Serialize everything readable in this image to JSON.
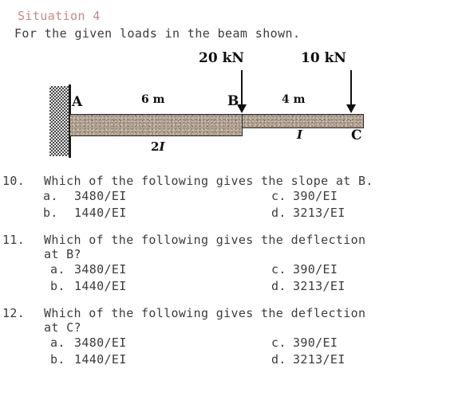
{
  "header": {
    "situation_title": "Situation 4",
    "intro": "For the given loads in the beam shown."
  },
  "figure": {
    "load_left_label": "20 kN",
    "load_right_label": "10 kN",
    "dim_left_label": "6 m",
    "dim_right_label": "4 m",
    "node_a": "A",
    "node_b": "B",
    "node_c": "C",
    "inertia_left_prefix": "2",
    "inertia_left_symbol": "I",
    "inertia_right_symbol": "I",
    "beam_type": "cantilever",
    "support": "fixed-wall-at-A",
    "colors": {
      "beam_fill": "#b0a08f",
      "beam_outline": "#2a2a2a",
      "wall_hatch": "#4a4a4a",
      "arrow": "#111111",
      "title": "#d4837f",
      "body_text": "#3c3c3c"
    }
  },
  "questions": [
    {
      "number": "10.",
      "text_line1": "Which of the following gives the slope at B.",
      "text_line2": "",
      "options": [
        {
          "key": "a.",
          "value": "3480/EI"
        },
        {
          "key": "c.",
          "value": "390/EI"
        },
        {
          "key": "b.",
          "value": "1440/EI"
        },
        {
          "key": "d.",
          "value": "3213/EI"
        }
      ]
    },
    {
      "number": "11.",
      "text_line1": "Which of the following gives the deflection",
      "text_line2": "at B?",
      "options": [
        {
          "key": "a.",
          "value": "3480/EI"
        },
        {
          "key": "c.",
          "value": "390/EI"
        },
        {
          "key": "b.",
          "value": "1440/EI"
        },
        {
          "key": "d.",
          "value": "3213/EI"
        }
      ]
    },
    {
      "number": "12.",
      "text_line1": "Which of the following gives the deflection",
      "text_line2": "at C?",
      "options": [
        {
          "key": "a.",
          "value": "3480/EI"
        },
        {
          "key": "c.",
          "value": "390/EI"
        },
        {
          "key": "b.",
          "value": "1440/EI"
        },
        {
          "key": "d.",
          "value": "3213/EI"
        }
      ]
    }
  ]
}
